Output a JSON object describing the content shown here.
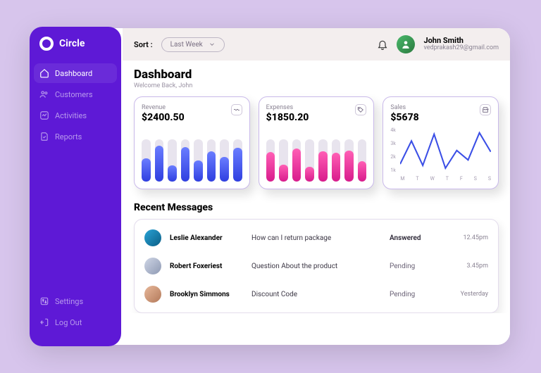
{
  "brand": "Circle",
  "sidebar": {
    "items": [
      {
        "label": "Dashboard",
        "icon": "home"
      },
      {
        "label": "Customers",
        "icon": "users"
      },
      {
        "label": "Activities",
        "icon": "activity"
      },
      {
        "label": "Reports",
        "icon": "report"
      }
    ],
    "bottom": [
      {
        "label": "Settings",
        "icon": "settings"
      },
      {
        "label": "Log Out",
        "icon": "logout"
      }
    ]
  },
  "topbar": {
    "sort_label": "Sort :",
    "sort_value": "Last Week",
    "user_name": "John Smith",
    "user_email": "vedprakash29@gmail.com"
  },
  "page": {
    "title": "Dashboard",
    "subtitle": "Welcome Back, John"
  },
  "cards": {
    "revenue": {
      "label": "Revenue",
      "value": "$2400.50"
    },
    "expenses": {
      "label": "Expenses",
      "value": "$1850.20"
    },
    "sales": {
      "label": "Sales",
      "value": "$5678"
    }
  },
  "chart_data": [
    {
      "type": "bar",
      "title": "Revenue",
      "values": [
        55,
        85,
        38,
        82,
        50,
        72,
        58,
        80
      ],
      "ylim": [
        0,
        100
      ],
      "color": "blue"
    },
    {
      "type": "bar",
      "title": "Expenses",
      "values": [
        70,
        40,
        78,
        35,
        72,
        68,
        74,
        48
      ],
      "ylim": [
        0,
        100
      ],
      "color": "pink"
    },
    {
      "type": "line",
      "title": "Sales",
      "x": [
        "M",
        "T",
        "W",
        "T",
        "F",
        "S",
        "S"
      ],
      "y_ticks": [
        "4k",
        "3k",
        "2k",
        "1k"
      ],
      "values": [
        1.3,
        3.0,
        1.2,
        3.5,
        1.0,
        2.3,
        1.6,
        3.6,
        2.2
      ],
      "ylim": [
        0,
        4
      ],
      "color": "#3b4fe6"
    }
  ],
  "messages": {
    "title": "Recent Messages",
    "rows": [
      {
        "name": "Leslie Alexander",
        "subject": "How can I return package",
        "status": "Answered",
        "time": "12.45pm"
      },
      {
        "name": "Robert Foxeriest",
        "subject": "Question About the product",
        "status": "Pending",
        "time": "3.45pm"
      },
      {
        "name": "Brooklyn Simmons",
        "subject": "Discount Code",
        "status": "Pending",
        "time": "Yesterday"
      }
    ]
  }
}
